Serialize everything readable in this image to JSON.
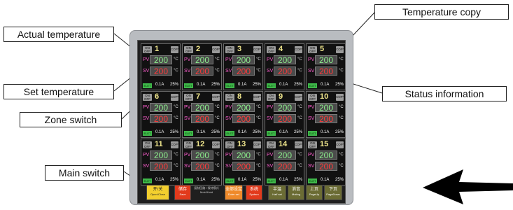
{
  "callouts": {
    "actual_temperature": "Actual temperature",
    "set_temperature": "Set temperature",
    "zone_switch": "Zone switch",
    "main_switch": "Main switch",
    "temperature_copy": "Temperature copy",
    "status_information": "Status information"
  },
  "zone_labels": {
    "onoff": [
      "ON",
      "OFF"
    ],
    "copy": "COPY",
    "pv": "PV",
    "sv": "SV",
    "unit": "°C",
    "status": "ELET"
  },
  "zones": [
    {
      "num": "1",
      "pv": "200",
      "sv": "200",
      "current": "0.1A",
      "percent": "25%"
    },
    {
      "num": "2",
      "pv": "200",
      "sv": "200",
      "current": "0.1A",
      "percent": "25%"
    },
    {
      "num": "3",
      "pv": "200",
      "sv": "200",
      "current": "0.1A",
      "percent": "25%"
    },
    {
      "num": "4",
      "pv": "200",
      "sv": "200",
      "current": "0.1A",
      "percent": "25%"
    },
    {
      "num": "5",
      "pv": "200",
      "sv": "200",
      "current": "0.1A",
      "percent": "25%"
    },
    {
      "num": "6",
      "pv": "200",
      "sv": "200",
      "current": "0.1A",
      "percent": "25%"
    },
    {
      "num": "7",
      "pv": "200",
      "sv": "200",
      "current": "0.1A",
      "percent": "25%"
    },
    {
      "num": "8",
      "pv": "200",
      "sv": "200",
      "current": "0.1A",
      "percent": "25%"
    },
    {
      "num": "9",
      "pv": "200",
      "sv": "200",
      "current": "0.1A",
      "percent": "25%"
    },
    {
      "num": "10",
      "pv": "200",
      "sv": "200",
      "current": "0.1A",
      "percent": "25%"
    },
    {
      "num": "11",
      "pv": "200",
      "sv": "200",
      "current": "0.1A",
      "percent": "25%"
    },
    {
      "num": "12",
      "pv": "200",
      "sv": "200",
      "current": "0.1A",
      "percent": "25%"
    },
    {
      "num": "13",
      "pv": "200",
      "sv": "200",
      "current": "0.1A",
      "percent": "25%"
    },
    {
      "num": "14",
      "pv": "200",
      "sv": "200",
      "current": "0.1A",
      "percent": "25%"
    },
    {
      "num": "15",
      "pv": "200",
      "sv": "200",
      "current": "0.1A",
      "percent": "25%"
    }
  ],
  "buttons": {
    "main": {
      "cn": "开/关",
      "en": "Open/Close"
    },
    "save": {
      "cn": "储存",
      "en": "Save"
    },
    "func": {
      "cn": "复制回路 / 保持模式",
      "en": "Mold/Hold"
    },
    "all": {
      "cn": "全部设定",
      "en": "Enter set"
    },
    "sys": {
      "cn": "系统",
      "en": "System"
    },
    "half": {
      "cn": "半温",
      "en": "Half set"
    },
    "mute": {
      "cn": "消音",
      "en": "Muting"
    },
    "pgup": {
      "cn": "上页",
      "en": "PageUp"
    },
    "pgdn": {
      "cn": "下页",
      "en": "PageDown"
    }
  },
  "colors": {
    "pv": "#8df08d",
    "sv": "#ff3b3b",
    "zone_number": "#f0e68c",
    "status_indicator": "#3fb84a"
  },
  "icons": {
    "arrow": "arrow-left-icon"
  }
}
